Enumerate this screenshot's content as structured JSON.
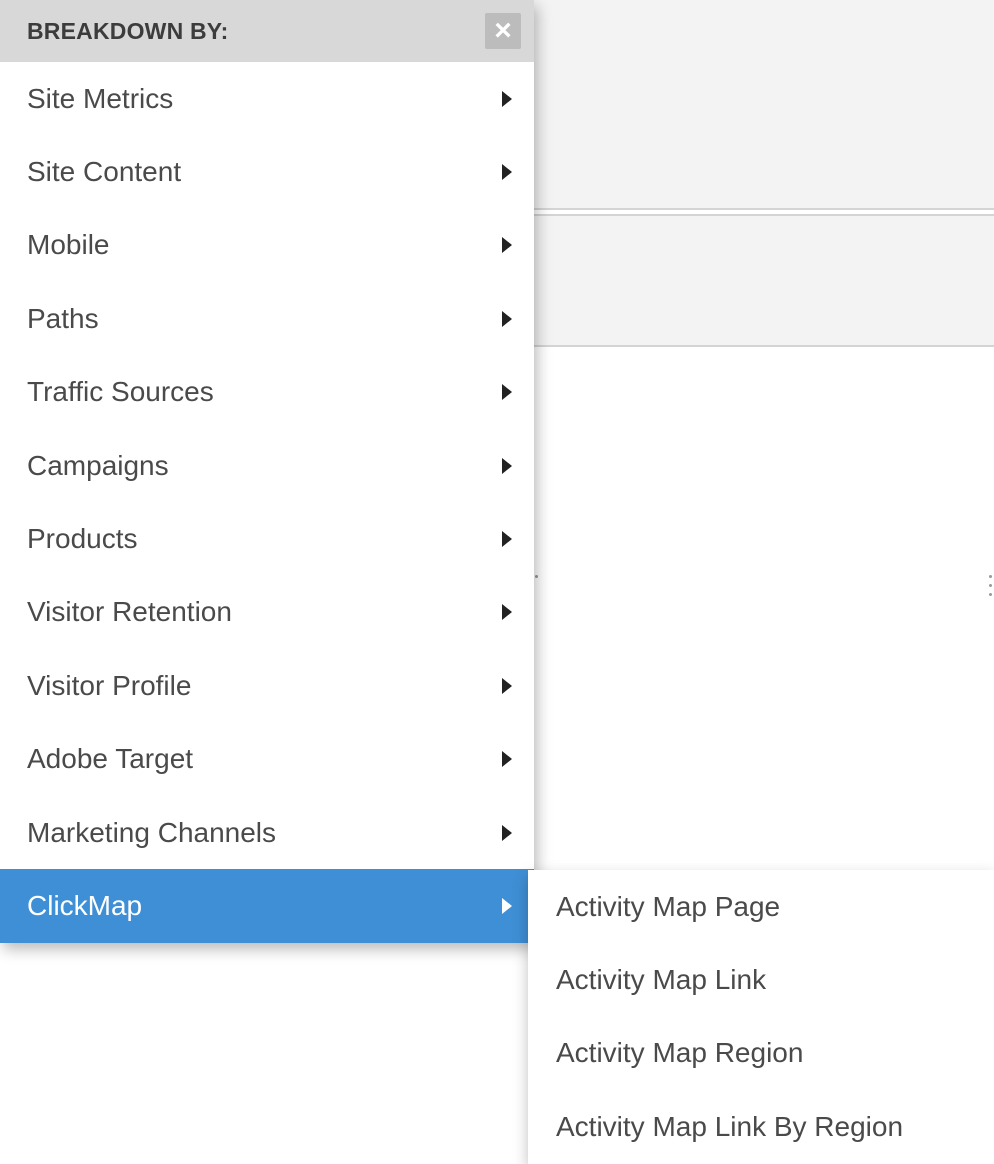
{
  "menu": {
    "title": "BREAKDOWN BY:",
    "close_icon": "close-icon",
    "items": [
      {
        "label": "Site Metrics"
      },
      {
        "label": "Site Content"
      },
      {
        "label": "Mobile"
      },
      {
        "label": "Paths"
      },
      {
        "label": "Traffic Sources"
      },
      {
        "label": "Campaigns"
      },
      {
        "label": "Products"
      },
      {
        "label": "Visitor Retention"
      },
      {
        "label": "Visitor Profile"
      },
      {
        "label": "Adobe Target"
      },
      {
        "label": "Marketing Channels"
      },
      {
        "label": "ClickMap"
      }
    ],
    "active_item": "ClickMap"
  },
  "submenu": {
    "items": [
      {
        "label": "Activity Map Page"
      },
      {
        "label": "Activity Map Link"
      },
      {
        "label": "Activity Map Region"
      },
      {
        "label": "Activity Map Link By Region"
      }
    ]
  },
  "colors": {
    "active_background": "#3f8fd6",
    "header_background": "#d8d8d8",
    "text": "#4a4a4a"
  }
}
